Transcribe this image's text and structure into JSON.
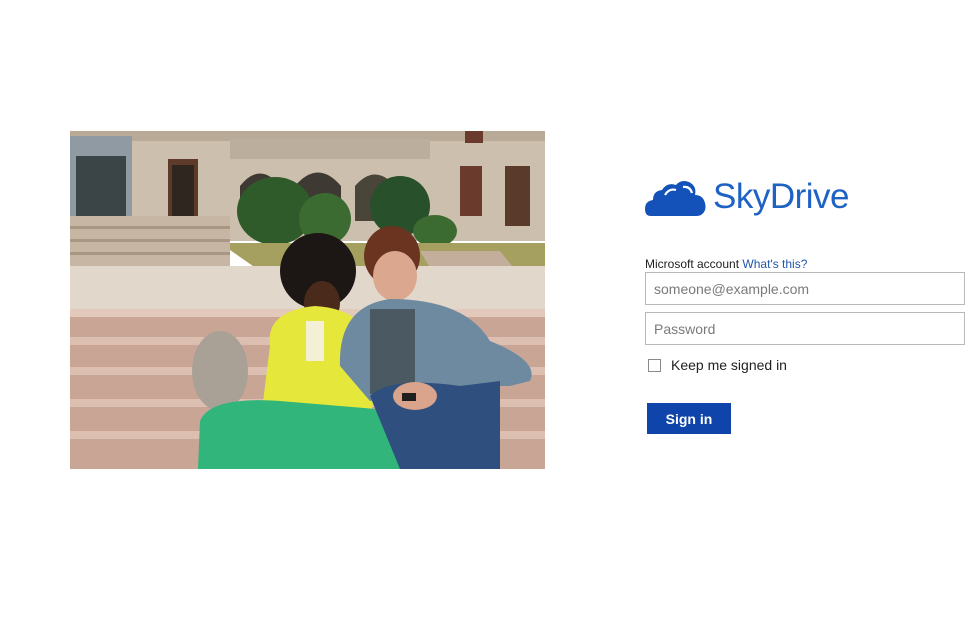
{
  "brand": {
    "name": "SkyDrive",
    "color": "#1e63c4",
    "logo_icon": "cloud-icon"
  },
  "hero": {
    "icon": "photo-two-students-on-steps"
  },
  "form": {
    "account_label": "Microsoft account",
    "account_link": "What's this?",
    "email_placeholder": "someone@example.com",
    "password_placeholder": "Password",
    "keep_signed_in_label": "Keep me signed in",
    "keep_signed_in_checked": false,
    "sign_in_label": "Sign in",
    "button_color": "#0f45ab"
  }
}
